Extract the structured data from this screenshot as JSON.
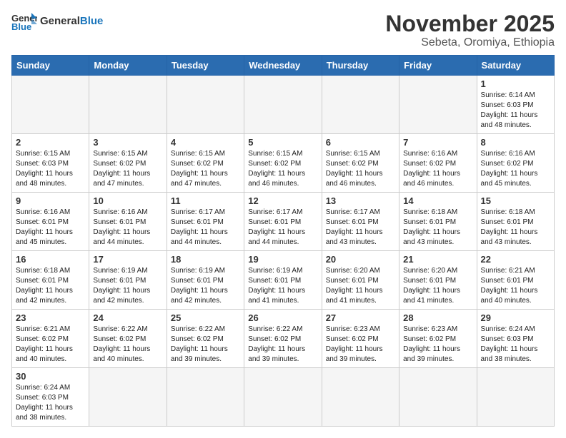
{
  "header": {
    "logo_general": "General",
    "logo_blue": "Blue",
    "month_title": "November 2025",
    "location": "Sebeta, Oromiya, Ethiopia"
  },
  "days_of_week": [
    "Sunday",
    "Monday",
    "Tuesday",
    "Wednesday",
    "Thursday",
    "Friday",
    "Saturday"
  ],
  "weeks": [
    [
      {
        "date": "",
        "info": ""
      },
      {
        "date": "",
        "info": ""
      },
      {
        "date": "",
        "info": ""
      },
      {
        "date": "",
        "info": ""
      },
      {
        "date": "",
        "info": ""
      },
      {
        "date": "",
        "info": ""
      },
      {
        "date": "1",
        "info": "Sunrise: 6:14 AM\nSunset: 6:03 PM\nDaylight: 11 hours\nand 48 minutes."
      }
    ],
    [
      {
        "date": "2",
        "info": "Sunrise: 6:15 AM\nSunset: 6:03 PM\nDaylight: 11 hours\nand 48 minutes."
      },
      {
        "date": "3",
        "info": "Sunrise: 6:15 AM\nSunset: 6:02 PM\nDaylight: 11 hours\nand 47 minutes."
      },
      {
        "date": "4",
        "info": "Sunrise: 6:15 AM\nSunset: 6:02 PM\nDaylight: 11 hours\nand 47 minutes."
      },
      {
        "date": "5",
        "info": "Sunrise: 6:15 AM\nSunset: 6:02 PM\nDaylight: 11 hours\nand 46 minutes."
      },
      {
        "date": "6",
        "info": "Sunrise: 6:15 AM\nSunset: 6:02 PM\nDaylight: 11 hours\nand 46 minutes."
      },
      {
        "date": "7",
        "info": "Sunrise: 6:16 AM\nSunset: 6:02 PM\nDaylight: 11 hours\nand 46 minutes."
      },
      {
        "date": "8",
        "info": "Sunrise: 6:16 AM\nSunset: 6:02 PM\nDaylight: 11 hours\nand 45 minutes."
      }
    ],
    [
      {
        "date": "9",
        "info": "Sunrise: 6:16 AM\nSunset: 6:01 PM\nDaylight: 11 hours\nand 45 minutes."
      },
      {
        "date": "10",
        "info": "Sunrise: 6:16 AM\nSunset: 6:01 PM\nDaylight: 11 hours\nand 44 minutes."
      },
      {
        "date": "11",
        "info": "Sunrise: 6:17 AM\nSunset: 6:01 PM\nDaylight: 11 hours\nand 44 minutes."
      },
      {
        "date": "12",
        "info": "Sunrise: 6:17 AM\nSunset: 6:01 PM\nDaylight: 11 hours\nand 44 minutes."
      },
      {
        "date": "13",
        "info": "Sunrise: 6:17 AM\nSunset: 6:01 PM\nDaylight: 11 hours\nand 43 minutes."
      },
      {
        "date": "14",
        "info": "Sunrise: 6:18 AM\nSunset: 6:01 PM\nDaylight: 11 hours\nand 43 minutes."
      },
      {
        "date": "15",
        "info": "Sunrise: 6:18 AM\nSunset: 6:01 PM\nDaylight: 11 hours\nand 43 minutes."
      }
    ],
    [
      {
        "date": "16",
        "info": "Sunrise: 6:18 AM\nSunset: 6:01 PM\nDaylight: 11 hours\nand 42 minutes."
      },
      {
        "date": "17",
        "info": "Sunrise: 6:19 AM\nSunset: 6:01 PM\nDaylight: 11 hours\nand 42 minutes."
      },
      {
        "date": "18",
        "info": "Sunrise: 6:19 AM\nSunset: 6:01 PM\nDaylight: 11 hours\nand 42 minutes."
      },
      {
        "date": "19",
        "info": "Sunrise: 6:19 AM\nSunset: 6:01 PM\nDaylight: 11 hours\nand 41 minutes."
      },
      {
        "date": "20",
        "info": "Sunrise: 6:20 AM\nSunset: 6:01 PM\nDaylight: 11 hours\nand 41 minutes."
      },
      {
        "date": "21",
        "info": "Sunrise: 6:20 AM\nSunset: 6:01 PM\nDaylight: 11 hours\nand 41 minutes."
      },
      {
        "date": "22",
        "info": "Sunrise: 6:21 AM\nSunset: 6:01 PM\nDaylight: 11 hours\nand 40 minutes."
      }
    ],
    [
      {
        "date": "23",
        "info": "Sunrise: 6:21 AM\nSunset: 6:02 PM\nDaylight: 11 hours\nand 40 minutes."
      },
      {
        "date": "24",
        "info": "Sunrise: 6:22 AM\nSunset: 6:02 PM\nDaylight: 11 hours\nand 40 minutes."
      },
      {
        "date": "25",
        "info": "Sunrise: 6:22 AM\nSunset: 6:02 PM\nDaylight: 11 hours\nand 39 minutes."
      },
      {
        "date": "26",
        "info": "Sunrise: 6:22 AM\nSunset: 6:02 PM\nDaylight: 11 hours\nand 39 minutes."
      },
      {
        "date": "27",
        "info": "Sunrise: 6:23 AM\nSunset: 6:02 PM\nDaylight: 11 hours\nand 39 minutes."
      },
      {
        "date": "28",
        "info": "Sunrise: 6:23 AM\nSunset: 6:02 PM\nDaylight: 11 hours\nand 39 minutes."
      },
      {
        "date": "29",
        "info": "Sunrise: 6:24 AM\nSunset: 6:03 PM\nDaylight: 11 hours\nand 38 minutes."
      }
    ],
    [
      {
        "date": "30",
        "info": "Sunrise: 6:24 AM\nSunset: 6:03 PM\nDaylight: 11 hours\nand 38 minutes."
      },
      {
        "date": "",
        "info": ""
      },
      {
        "date": "",
        "info": ""
      },
      {
        "date": "",
        "info": ""
      },
      {
        "date": "",
        "info": ""
      },
      {
        "date": "",
        "info": ""
      },
      {
        "date": "",
        "info": ""
      }
    ]
  ]
}
